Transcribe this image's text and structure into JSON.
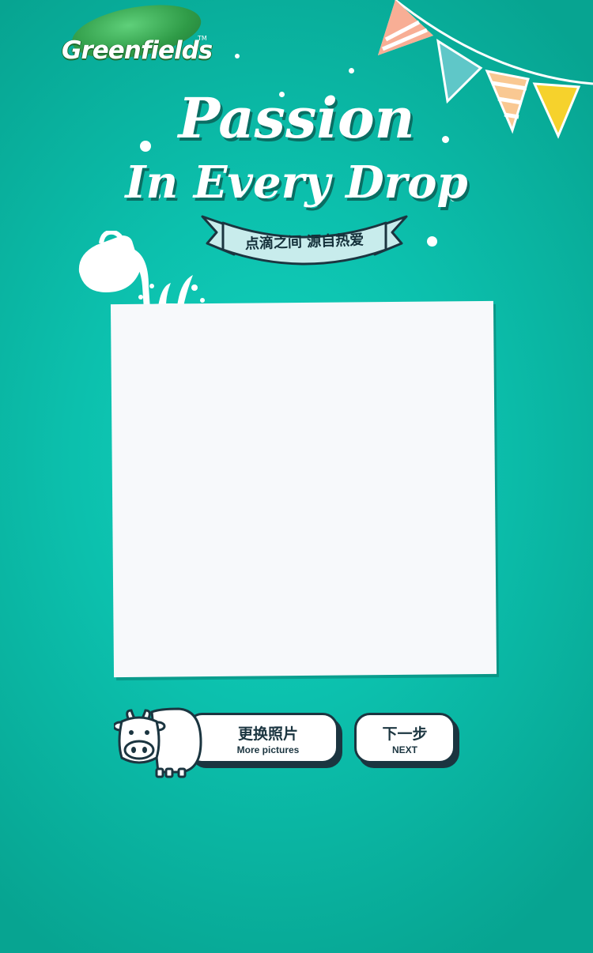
{
  "brand": {
    "logo_text": "Greenfields",
    "trademark": "TM"
  },
  "headline": {
    "line1": "Passion",
    "line2": "In Every Drop"
  },
  "ribbon": {
    "text": "点滴之间  源自热爱"
  },
  "actions": {
    "more": {
      "label_cn": "更换照片",
      "label_en": "More pictures"
    },
    "next": {
      "label_cn": "下一步",
      "label_en": "NEXT"
    }
  },
  "colors": {
    "background": "#0cc0ad",
    "text_dark": "#1b3540",
    "flag_1": "#f7a58a",
    "flag_2": "#5fc7c8",
    "flag_3": "#f9c892",
    "flag_4": "#f6d22c"
  },
  "icons": [
    "milk-pitcher-icon",
    "cow-icon",
    "bunting-flags"
  ]
}
